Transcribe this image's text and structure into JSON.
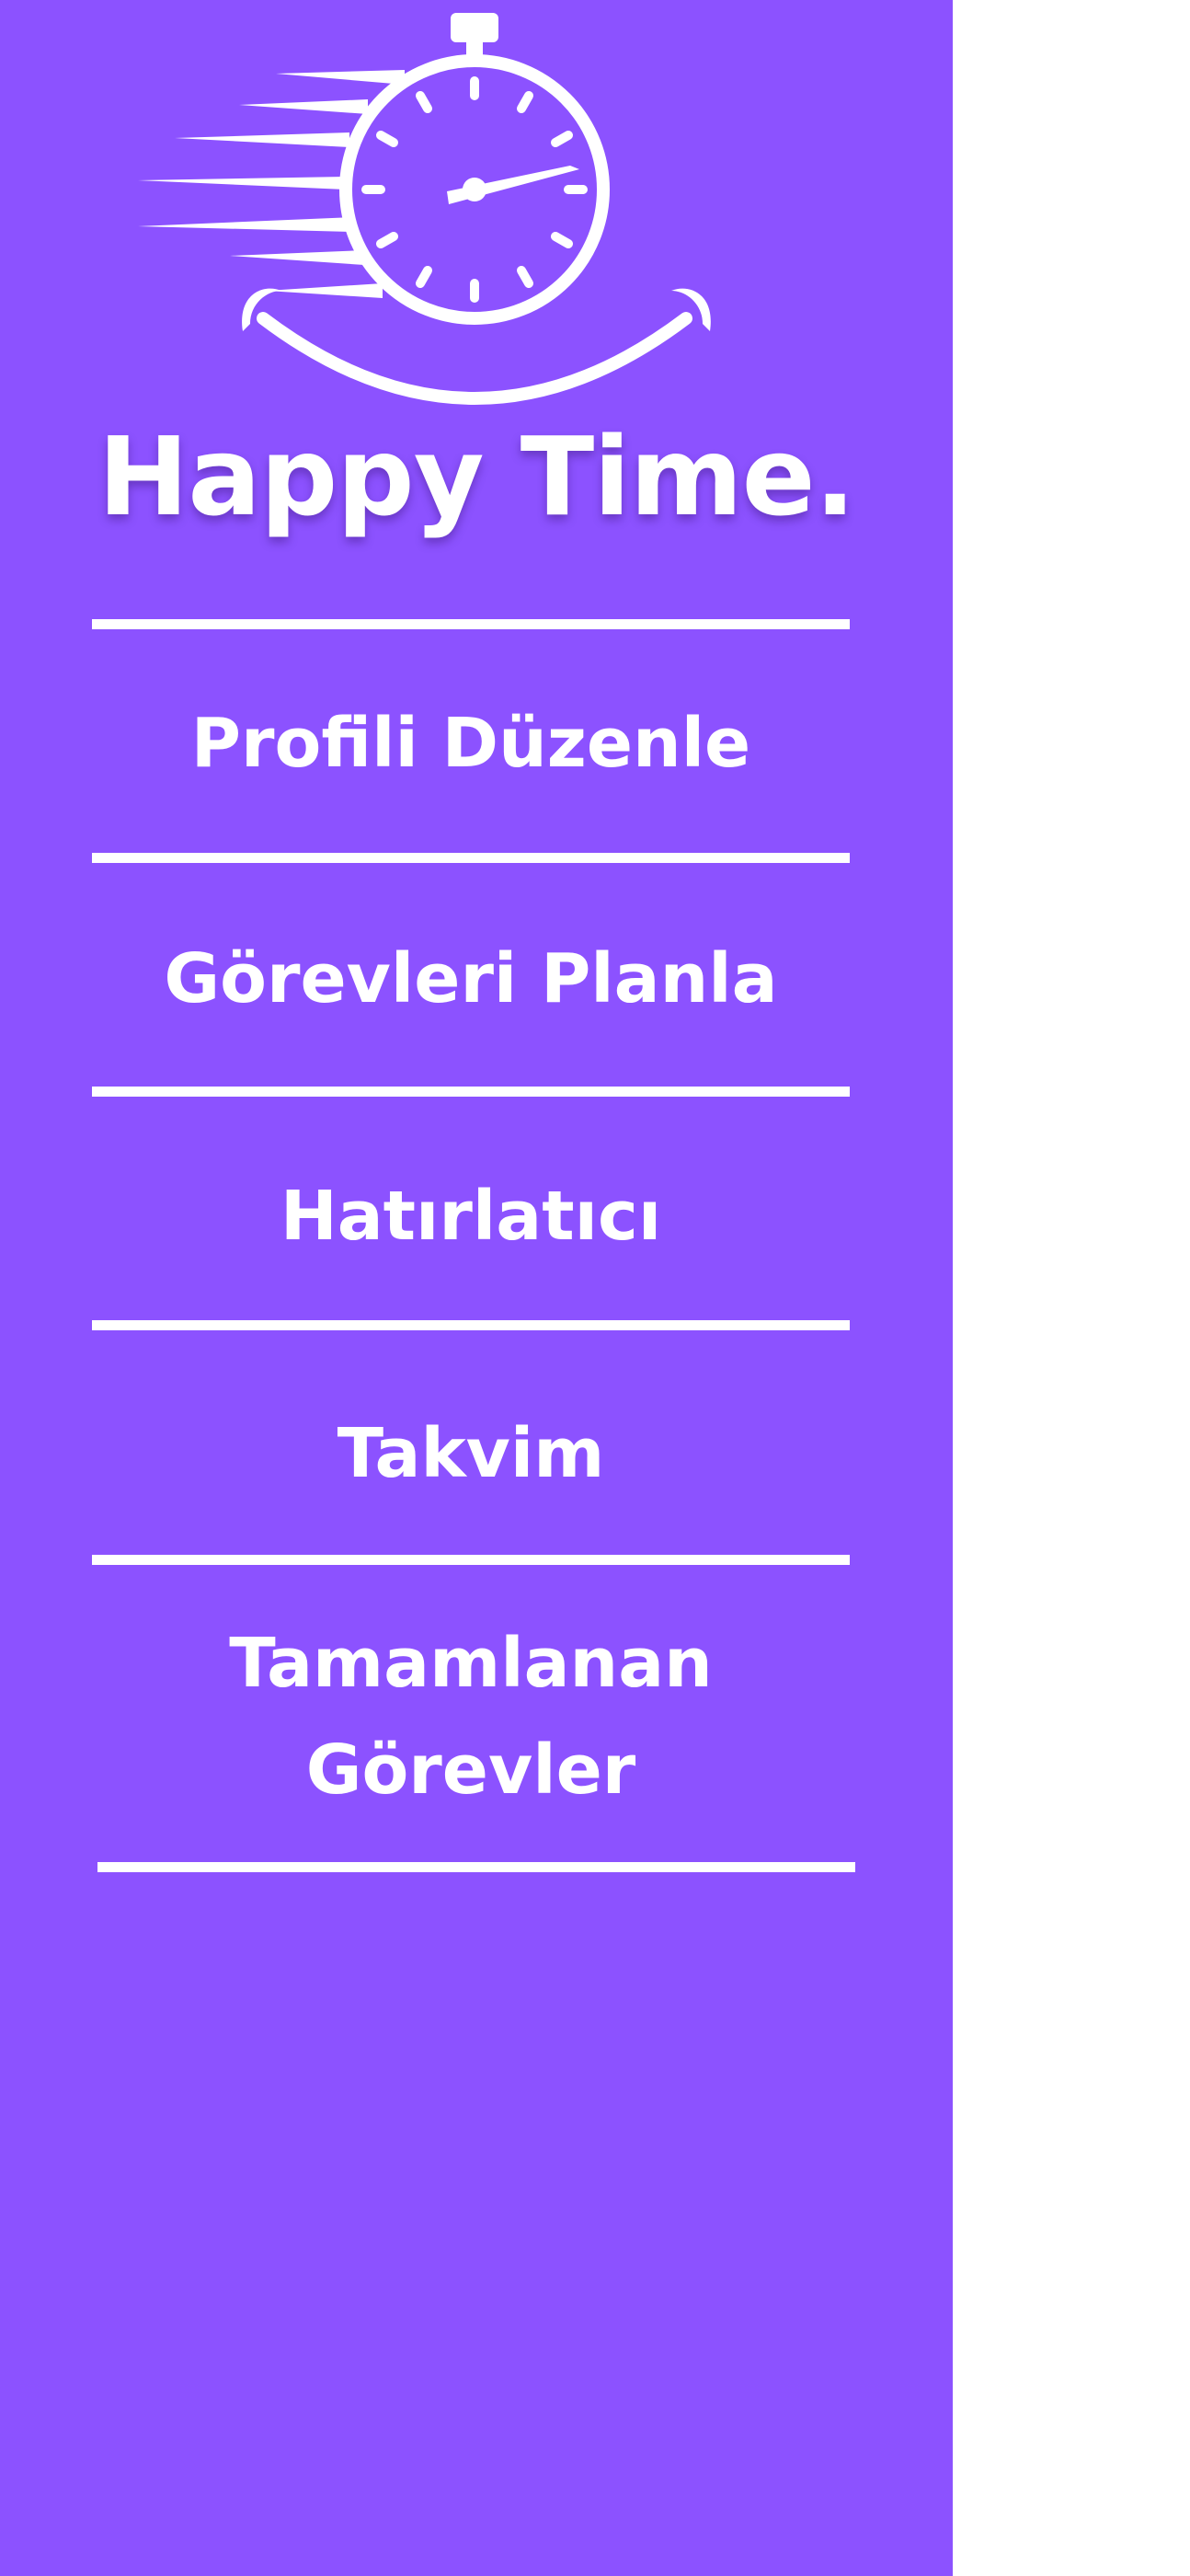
{
  "app": {
    "title": "Happy Time."
  },
  "logo": {
    "icon": "stopwatch-smile-icon"
  },
  "menu": {
    "items": [
      {
        "label": "Profili Düzenle"
      },
      {
        "label": "Görevleri Planla"
      },
      {
        "label": "Hatırlatıcı"
      },
      {
        "label": "Takvim"
      },
      {
        "label": "Tamamlanan Görevler"
      }
    ]
  },
  "colors": {
    "sidebar": "#8c52ff",
    "foreground": "#ffffff",
    "background": "#ffffff"
  }
}
